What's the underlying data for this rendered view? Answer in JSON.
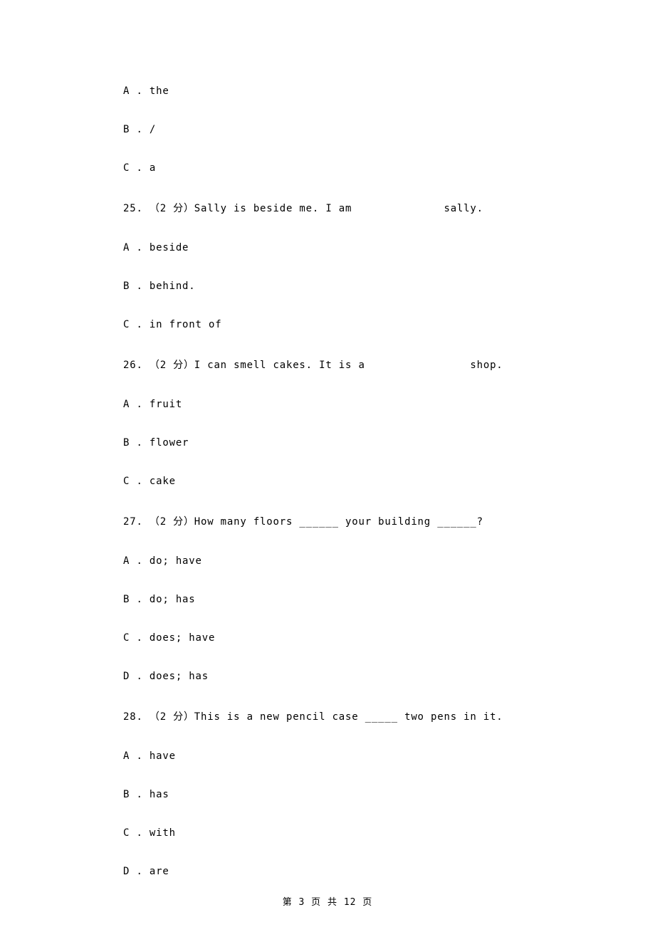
{
  "q24": {
    "A": "A . the",
    "B": "B . /",
    "C": "C . a"
  },
  "q25": {
    "stem": "25. （2 分）Sally is beside me. I am              sally.",
    "A": "A . beside",
    "B": "B . behind.",
    "C": "C . in front of"
  },
  "q26": {
    "stem": "26. （2 分）I can smell cakes. It is a                shop.",
    "A": "A . fruit",
    "B": "B . flower",
    "C": "C . cake"
  },
  "q27": {
    "stem": "27. （2 分）How many floors ______ your building ______?",
    "A": "A . do; have",
    "B": "B . do; has",
    "C": "C . does; have",
    "D": "D . does; has"
  },
  "q28": {
    "stem": "28. （2 分）This is a new pencil case _____ two pens in it.",
    "A": "A . have",
    "B": "B . has",
    "C": "C . with",
    "D": "D . are"
  },
  "footer": "第 3 页 共 12 页"
}
